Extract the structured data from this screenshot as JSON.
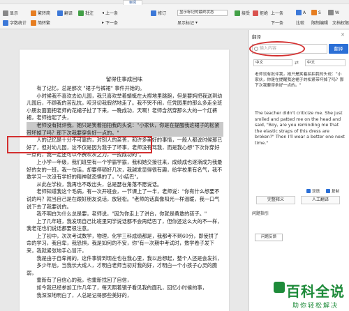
{
  "ribbon": {
    "tab_active": "审阅",
    "row1": [
      {
        "label": "显示",
        "icon": "show-icon"
      },
      {
        "label": "字数统计",
        "icon": "word-count-icon"
      },
      {
        "label": "繁转简",
        "icon": "convert-icon"
      },
      {
        "label": "简转繁",
        "icon": "convert2-icon"
      },
      {
        "label": "翻译",
        "icon": "translate-icon"
      },
      {
        "label": "批注",
        "icon": "comment-icon"
      }
    ],
    "group": {
      "prev": "上一条",
      "next": "下一条",
      "nav_prev": "上一条",
      "nav_next": "下一条"
    },
    "track": {
      "label": "修订",
      "option": "显示标记的最终状态",
      "show_markup": "显示标记",
      "review_pane": "审阅"
    },
    "accept": "接受",
    "reject": "拒绝",
    "compare": "比较",
    "restrict": "限制编辑",
    "doc_perm": "文档权限",
    "top_icons": [
      "A",
      "S",
      "W"
    ]
  },
  "document": {
    "title": "留得住事成回味",
    "paragraphs": [
      "有了记忆，总是那次 \"裙子与裤裙\" 事件开始的。",
      "小时候我不喜欢去幼儿园，我只喜欢举着蜻蜓在大襟地里跳跑，但是要妈把我送到幼儿园后，不顾我的苦乱抗，咬牙切我假然地走了。我不哭不闹，任凭园里的那么多走全班小朋友面面把老师的花裙子扯了下来，一晚成功，天啊！老师含然穿那么大的一个红裤裙，老师抬起了头，",
      "老师没有批评我，她只是笑着拍拍我的头说：\"小家伙，你是在提醒我这裙子的松紧带坏掉了吗？那下次我要穿条好一点的。\"",
      "人的记忆是十分不可靠的，对别人的亲善，和许多美好的事情，一般人都说时候那已好了，但对幼儿园，这不仅是因为我于了坏事，老师没有骂我，而是我心想\"下次你穿好一点的，我一定还可以不费吹灰之力，一找成功的\"。",
      "上小学一年级，我们班里有一个学霸学霸，我和她交接往来，成绩成也逐渐成为我最好的女的一班，我一句话，却要停顿好几次，我越发显得很有趣，给学校里有名气，我不敢学习一次没有学好的精神就恐惧的了，\"小结巴\"。",
      "从此在学校，我再也不敢出头，总是瑟在角落不愿说话。",
      "老师知道我这个毛病，有一次开班会，一节课上了一半，老师说：\"你有什么想要不说的吗？就当自己是在跟好朋友说话，放轻松。\"老师的话真像阳光一样温暖，我一口气说下去了我要说的。",
      "我不明白为什么总是要，老师说，\"因为你走上了讲台，你就是勇敢的孩子。\"",
      "上了几年班，我发现自己比班里同学说话都不会再结巴了，但你还这么大的不一样，我老花也们说话都要很注意。",
      "上了初中，次次考试数学，物理，化学三科成绩都是，我都考不到60分，即使拼了命的学习，我自卑，我恐惧，我是如何的不安，你\"有一次期中考试时，数学卷子发下来，我就紧张地手心冒汗，",
      "我是由于自卑闹的，这件事情到现在也在我心里，我以后想起，整个人还是会发抖，",
      "多少年后，当我长大成人，才明白老师当初对我的好，才明白一个小孩子心灵的脆弱，",
      "重新有了自信心的我，也重新找回了自信，",
      "如今我已经参加工作几年了，每天照着镜子看见我的面孔，回忆小时候的事，",
      "我深深地明白了，人总是记得那些美好的，"
    ]
  },
  "panel": {
    "title": "翻译",
    "search_placeholder": "输入内容",
    "translate_button": "翻译",
    "source_lang": "中文",
    "target_lang": "中文",
    "source_text": "老师没有批评我，她只是笑着拍拍我的头说：\"小家伙，你是在提醒我这裙子的松紧带坏掉了吗？那下次我要穿条好一点的。\"",
    "target_text": "The teacher didn't criticize me. She just smiled and patted me on the head and said, \"Boy, are you reminding me that the elastic straps of this dress are broken?\" Then I'll wear a better one next time.\"",
    "opt_bilingual": "双语",
    "opt_copy": "复制",
    "btn_complete": "完整释义",
    "btn_human": "人工翻译",
    "section_help": "问题指引",
    "feedback": "问题反馈"
  },
  "watermark": {
    "main": "百科全说",
    "sub": "助你轻松解决"
  }
}
